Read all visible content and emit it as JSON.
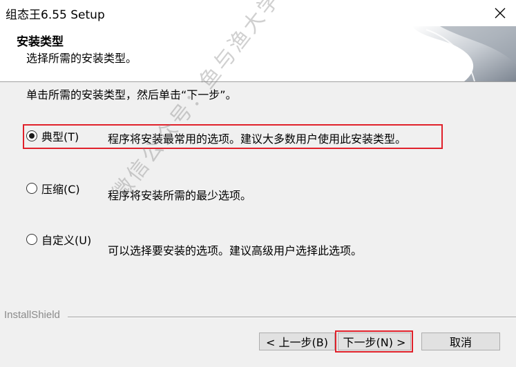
{
  "window": {
    "title": "组态王6.55 Setup",
    "close_icon": "close-icon"
  },
  "header": {
    "title": "安装类型",
    "subtitle": "选择所需的安装类型。"
  },
  "instruction": "单击所需的安装类型，然后单击“下一步”。",
  "options": [
    {
      "label": "典型(T)",
      "description": "程序将安装最常用的选项。建议大多数用户使用此安装类型。",
      "selected": true
    },
    {
      "label": "压缩(C)",
      "description": "程序将安装所需的最少选项。",
      "selected": false
    },
    {
      "label": "自定义(U)",
      "description": "可以选择要安装的选项。建议高级用户选择此选项。",
      "selected": false
    }
  ],
  "footer": {
    "brand": "InstallShield"
  },
  "buttons": {
    "back": "< 上一步(B)",
    "next": "下一步(N) >",
    "cancel": "取消"
  },
  "watermark": "微信公众号：鱼与渔大学生服务",
  "colors": {
    "highlight": "#e0202a",
    "background": "#f0f0f0"
  }
}
